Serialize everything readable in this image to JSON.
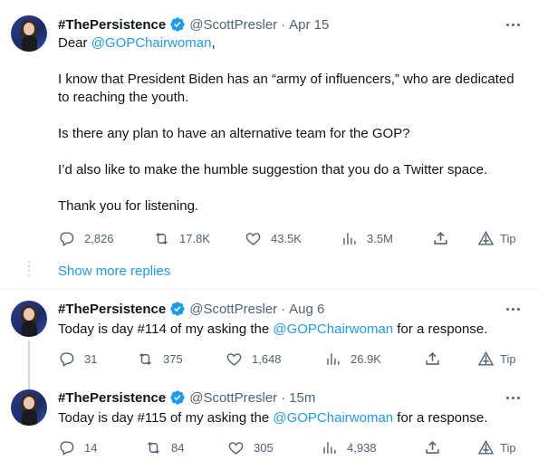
{
  "tweets": [
    {
      "name": "#ThePersistence",
      "handle": "@ScottPresler",
      "time": "Apr 15",
      "paragraphs": [
        {
          "before": "Dear ",
          "mention": "@GOPChairwoman",
          "after": ","
        },
        {
          "text": "I know that President Biden has an “army of influencers,” who are dedicated to reaching the youth."
        },
        {
          "text": "Is there any plan to have an alternative team for the GOP?"
        },
        {
          "text": "I’d also like to make the humble suggestion that you do a Twitter space."
        },
        {
          "text": "Thank you for listening."
        }
      ],
      "stats": {
        "replies": "2,826",
        "retweets": "17.8K",
        "likes": "43.5K",
        "views": "3.5M",
        "tip": "Tip"
      }
    },
    {
      "name": "#ThePersistence",
      "handle": "@ScottPresler",
      "time": "Aug 6",
      "paragraphs": [
        {
          "before": "Today is day #114 of my asking the ",
          "mention": "@GOPChairwoman",
          "after": " for a response."
        }
      ],
      "stats": {
        "replies": "31",
        "retweets": "375",
        "likes": "1,648",
        "views": "26.9K",
        "tip": "Tip"
      }
    },
    {
      "name": "#ThePersistence",
      "handle": "@ScottPresler",
      "time": "15m",
      "paragraphs": [
        {
          "before": "Today is day #115 of my asking the ",
          "mention": "@GOPChairwoman",
          "after": " for a response."
        }
      ],
      "stats": {
        "replies": "14",
        "retweets": "84",
        "likes": "305",
        "views": "4,938",
        "tip": "Tip"
      }
    }
  ],
  "show_more_replies": "Show more replies",
  "separator": "·",
  "colors": {
    "link": "#1d9bf0",
    "verified": "#1d9bf0",
    "muted": "#536471",
    "text": "#0f1419"
  },
  "icons": [
    "verified-badge-icon",
    "more-icon",
    "reply-icon",
    "retweet-icon",
    "like-icon",
    "views-icon",
    "share-icon",
    "tip-icon"
  ]
}
